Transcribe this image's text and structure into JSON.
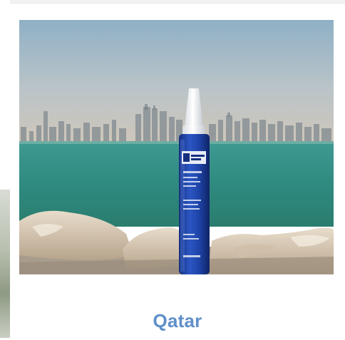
{
  "card": {
    "caption": "Qatar",
    "caption_color": "#5f8fc9"
  },
  "photo": {
    "subject": "blue-threadlocker-tube-on-waterfront-rocks",
    "tube_label_lines": [
      "LOCK",
      "DETECT"
    ]
  }
}
